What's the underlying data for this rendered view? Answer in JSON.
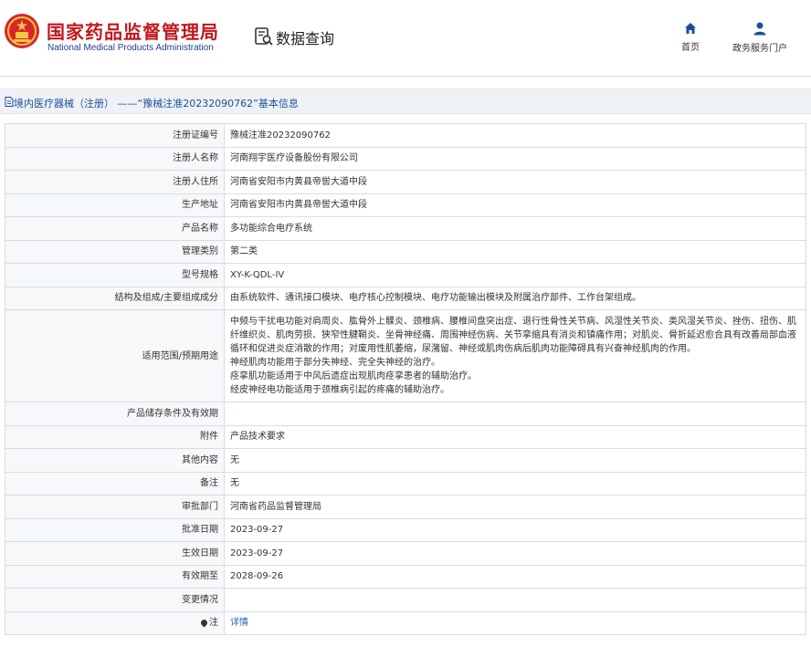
{
  "header": {
    "org_cn": "国家药品监督管理局",
    "org_en": "National Medical Products Administration",
    "query_title": "数据查询",
    "nav": [
      {
        "label": "首页",
        "icon": "home-icon"
      },
      {
        "label": "政务服务门户",
        "icon": "user-icon"
      }
    ]
  },
  "breadcrumb": {
    "text": "境内医疗器械（注册） ——“豫械注准20232090762”基本信息"
  },
  "rows": [
    {
      "label": "注册证编号",
      "value": "豫械注准20232090762"
    },
    {
      "label": "注册人名称",
      "value": "河南翔宇医疗设备股份有限公司"
    },
    {
      "label": "注册人住所",
      "value": "河南省安阳市内黄县帝喾大道中段"
    },
    {
      "label": "生产地址",
      "value": "河南省安阳市内黄县帝喾大道中段"
    },
    {
      "label": "产品名称",
      "value": "多功能综合电疗系统"
    },
    {
      "label": "管理类别",
      "value": "第二类"
    },
    {
      "label": "型号规格",
      "value": "XY-K-QDL-IV"
    },
    {
      "label": "结构及组成/主要组成成分",
      "value": "由系统软件、通讯接口模块、电疗核心控制模块、电疗功能输出模块及附属治疗部件、工作台架组成。"
    },
    {
      "label": "适用范围/预期用途",
      "lines": [
        "中频与干扰电功能对肩周炎、肱骨外上髁炎、颈椎病、腰椎间盘突出症、退行性骨性关节病、风湿性关节炎、类风湿关节炎、挫伤、扭伤、肌纤维织炎、肌肉劳损、狭窄性腱鞘炎、坐骨神经痛、周围神经伤病、关节挛缩具有消炎和镇痛作用；对肌炎、骨折延迟愈合具有改善局部血液循环和促进炎症消散的作用；对废用性肌萎缩，尿潴留、神经或肌肉伤病后肌肉功能障碍具有兴奋神经肌肉的作用。",
        "神经肌肉功能用于部分失神经、完全失神经的治疗。",
        "痉挛肌功能适用于中风后遗症出现肌肉痉挛患者的辅助治疗。",
        "经皮神经电功能适用于颈椎病引起的疼痛的辅助治疗。"
      ]
    },
    {
      "label": "产品储存条件及有效期",
      "value": ""
    },
    {
      "label": "附件",
      "value": "产品技术要求"
    },
    {
      "label": "其他内容",
      "value": "无"
    },
    {
      "label": "备注",
      "value": "无"
    },
    {
      "label": "审批部门",
      "value": "河南省药品监督管理局"
    },
    {
      "label": "批准日期",
      "value": "2023-09-27"
    },
    {
      "label": "生效日期",
      "value": "2023-09-27"
    },
    {
      "label": "有效期至",
      "value": "2028-09-26"
    },
    {
      "label": "变更情况",
      "value": ""
    },
    {
      "label": "注",
      "value": "详情",
      "link": true
    }
  ],
  "colors": {
    "brand_red": "#c3161c",
    "brand_blue": "#1d3f8f",
    "link_blue": "#1d5fb4",
    "label_bg": "#f7f8fa",
    "border": "#d8dde3"
  }
}
